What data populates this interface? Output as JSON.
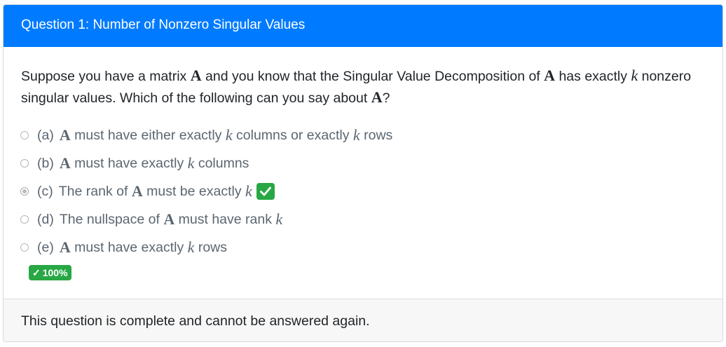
{
  "header": {
    "title": "Question 1: Number of Nonzero Singular Values"
  },
  "question": {
    "t1": "Suppose you have a matrix ",
    "m_A1": "A",
    "t2": " and you know that the Singular Value Decomposition of ",
    "m_A2": "A",
    "t3": " has exactly ",
    "m_k": "k",
    "t4": " nonzero singular values. Which of the following can you say about ",
    "m_A3": "A",
    "t5": "?"
  },
  "options": [
    {
      "key": "(a)",
      "m1": "A",
      "t1": " must have either exactly ",
      "m2": "k",
      "t2": " columns or exactly ",
      "m3": "k",
      "t3": " rows",
      "selected": false,
      "correct": false
    },
    {
      "key": "(b)",
      "m1": "A",
      "t1": " must have exactly ",
      "m2": "k",
      "t2": " columns",
      "selected": false,
      "correct": false
    },
    {
      "key": "(c)",
      "t0": "The rank of ",
      "m1": "A",
      "t1": " must be exactly ",
      "m2": "k",
      "selected": true,
      "correct": true
    },
    {
      "key": "(d)",
      "t0": "The nullspace of ",
      "m1": "A",
      "t1": " must have rank ",
      "m2": "k",
      "selected": false,
      "correct": false
    },
    {
      "key": "(e)",
      "m1": "A",
      "t1": " must have exactly ",
      "m2": "k",
      "t2": " rows",
      "selected": false,
      "correct": false
    }
  ],
  "icons": {
    "correct_mark": "check-icon",
    "score_mark": "check-icon"
  },
  "score": {
    "check": "✓",
    "label": "100%"
  },
  "footer": {
    "text": "This question is complete and cannot be answered again."
  },
  "colors": {
    "header_bg": "#007bff",
    "success": "#28a745",
    "footer_bg": "#f7f7f7"
  }
}
